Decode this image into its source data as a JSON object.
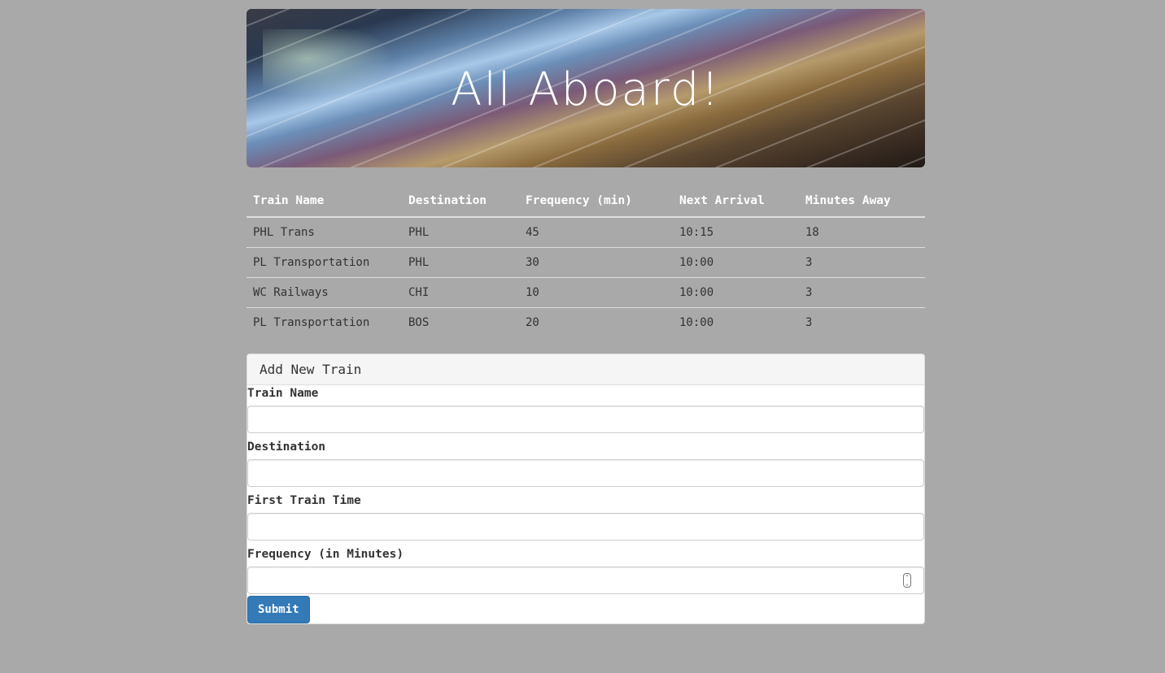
{
  "header": {
    "title": "All Aboard!"
  },
  "table": {
    "columns": [
      "Train Name",
      "Destination",
      "Frequency (min)",
      "Next Arrival",
      "Minutes Away"
    ],
    "rows": [
      [
        "PHL Trans",
        "PHL",
        "45",
        "10:15",
        "18"
      ],
      [
        "PL Transportation",
        "PHL",
        "30",
        "10:00",
        "3"
      ],
      [
        "WC Railways",
        "CHI",
        "10",
        "10:00",
        "3"
      ],
      [
        "PL Transportation",
        "BOS",
        "20",
        "10:00",
        "3"
      ]
    ]
  },
  "form": {
    "heading": "Add New Train",
    "train_name_label": "Train Name",
    "train_name_value": "",
    "destination_label": "Destination",
    "destination_value": "",
    "first_train_label": "First Train Time",
    "first_train_value": "",
    "frequency_label": "Frequency (in Minutes)",
    "frequency_value": "",
    "submit_label": "Submit"
  },
  "colors": {
    "page_background": "#a9a9a9",
    "primary_button": "#337ab7",
    "panel_heading": "#f5f5f5"
  },
  "icons": {
    "number_spinner": "spinner-arrows-icon"
  }
}
